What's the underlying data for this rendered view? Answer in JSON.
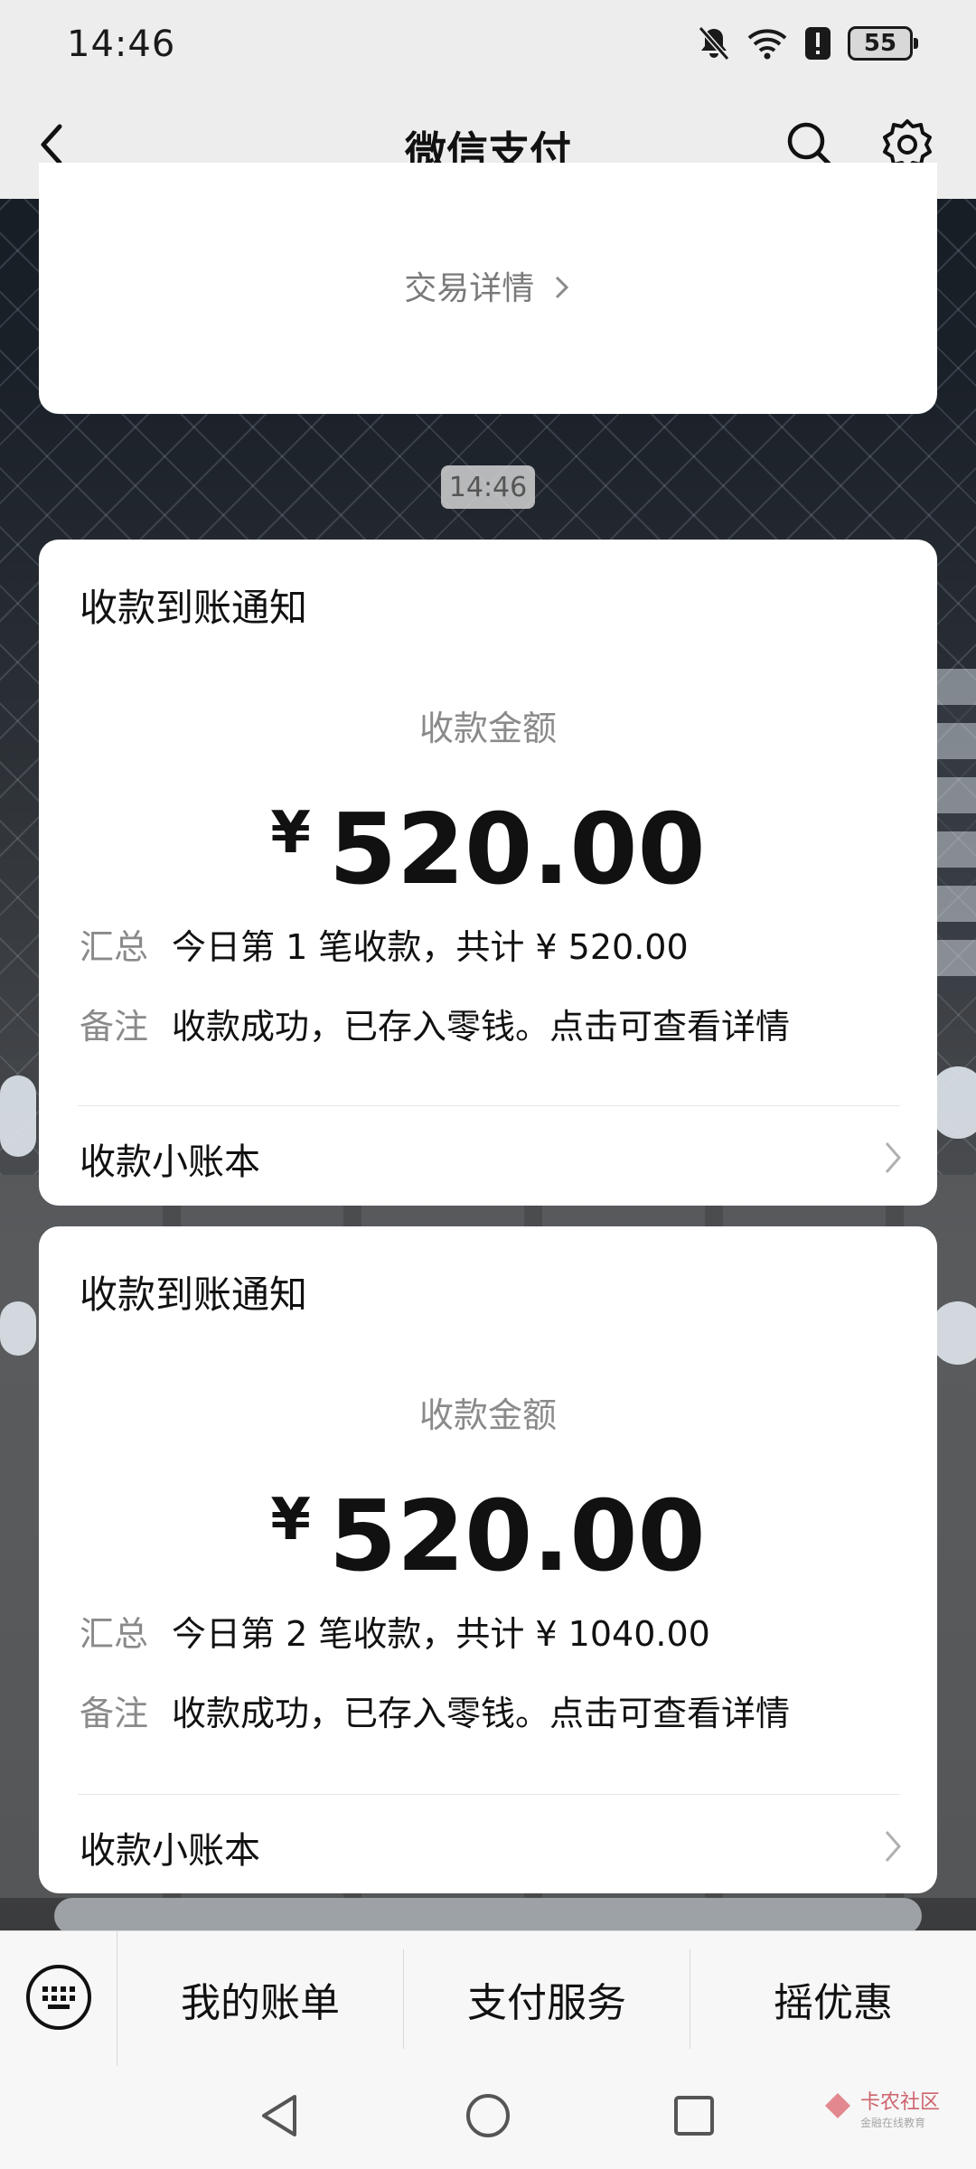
{
  "status_bar": {
    "time": "14:46",
    "battery": "55",
    "icons": [
      "bell-off-icon",
      "wifi-icon",
      "alert-icon",
      "battery-icon"
    ]
  },
  "nav": {
    "title": "微信支付",
    "icons": [
      "back-icon",
      "search-icon",
      "gear-icon"
    ]
  },
  "top_card": {
    "detail_link": "交易详情"
  },
  "timestamp": "14:46",
  "notifications": [
    {
      "title": "收款到账通知",
      "amount_label": "收款金额",
      "currency": "¥",
      "amount": "520.00",
      "summary_key": "汇总",
      "summary_value": "今日第 1 笔收款，共计 ¥ 520.00",
      "remark_key": "备注",
      "remark_value": "收款成功，已存入零钱。点击可查看详情",
      "ledger": "收款小账本"
    },
    {
      "title": "收款到账通知",
      "amount_label": "收款金额",
      "currency": "¥",
      "amount": "520.00",
      "summary_key": "汇总",
      "summary_value": "今日第 2 笔收款，共计 ¥ 1040.00",
      "remark_key": "备注",
      "remark_value": "收款成功，已存入零钱。点击可查看详情",
      "ledger": "收款小账本"
    }
  ],
  "bottom_menu": {
    "items": [
      "我的账单",
      "支付服务",
      "摇优惠"
    ]
  },
  "system_nav": [
    "back-triangle-icon",
    "home-circle-icon",
    "recents-square-icon"
  ],
  "watermark": {
    "text": "卡农社区",
    "sub": "金融在线教育"
  },
  "colors": {
    "nav_bg": "#ededed",
    "card_bg": "#ffffff",
    "text": "#111111",
    "muted": "#8a8a8a"
  }
}
